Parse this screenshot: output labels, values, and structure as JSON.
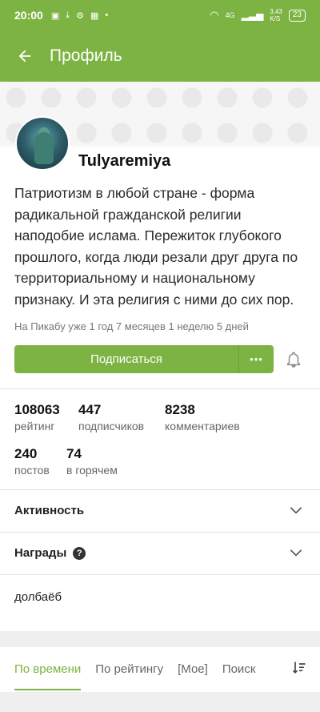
{
  "status_bar": {
    "time": "20:00",
    "net_speed": "3,43\nK/S",
    "net_type": "4G",
    "battery": "23"
  },
  "appbar": {
    "title": "Профиль"
  },
  "profile": {
    "username": "Tulyaremiya",
    "bio": "Патриотизм в любой стране - форма радикальной гражданской религии наподобие ислама. Пережиток глубокого прошлого, когда люди резали друг друга по территориальному и национальному признаку. И эта религия с ними до сих пор.",
    "since": "На Пикабу уже 1 год 7 месяцев 1 неделю 5 дней",
    "subscribe_label": "Подписаться",
    "more_label": "•••"
  },
  "stats": [
    {
      "value": "108063",
      "label": "рейтинг"
    },
    {
      "value": "447",
      "label": "подписчиков"
    },
    {
      "value": "8238",
      "label": "комментариев"
    },
    {
      "value": "240",
      "label": "постов"
    },
    {
      "value": "74",
      "label": "в горячем"
    }
  ],
  "sections": {
    "activity": "Активность",
    "awards": "Награды",
    "awards_help": "?"
  },
  "note": "долбаёб",
  "tabs": [
    {
      "label": "По времени",
      "active": true
    },
    {
      "label": "По рейтингу",
      "active": false
    },
    {
      "label": "[Мое]",
      "active": false
    },
    {
      "label": "Поиск",
      "active": false
    }
  ],
  "colors": {
    "accent": "#7cb342"
  },
  "icons": [
    "back-arrow-icon",
    "bell-icon",
    "chevron-down-icon",
    "question-icon",
    "sort-icon"
  ]
}
